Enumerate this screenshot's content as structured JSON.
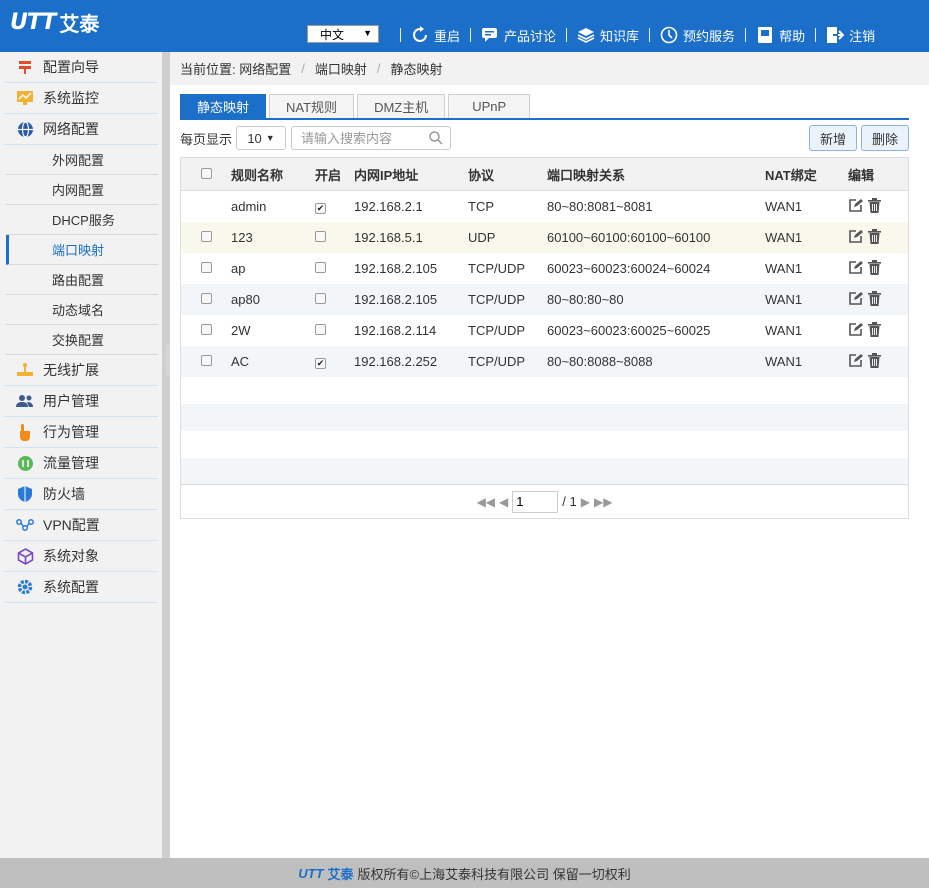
{
  "header": {
    "logo_mark": "UTT",
    "logo_cn": "艾泰",
    "language": "中文",
    "nav": [
      {
        "label": "重启",
        "icon": "restart-icon"
      },
      {
        "label": "产品讨论",
        "icon": "discussion-icon"
      },
      {
        "label": "知识库",
        "icon": "knowledge-base-icon"
      },
      {
        "label": "预约服务",
        "icon": "appointment-icon"
      },
      {
        "label": "帮助",
        "icon": "help-icon"
      },
      {
        "label": "注销",
        "icon": "logout-icon"
      }
    ]
  },
  "sidebar": {
    "items": [
      {
        "label": "配置向导",
        "icon": "wizard-icon"
      },
      {
        "label": "系统监控",
        "icon": "monitor-icon"
      },
      {
        "label": "网络配置",
        "icon": "network-icon"
      },
      {
        "label": "无线扩展",
        "icon": "wireless-icon"
      },
      {
        "label": "用户管理",
        "icon": "users-icon"
      },
      {
        "label": "行为管理",
        "icon": "behavior-icon"
      },
      {
        "label": "流量管理",
        "icon": "traffic-icon"
      },
      {
        "label": "防火墙",
        "icon": "firewall-icon"
      },
      {
        "label": "VPN配置",
        "icon": "vpn-icon"
      },
      {
        "label": "系统对象",
        "icon": "objects-icon"
      },
      {
        "label": "系统配置",
        "icon": "settings-icon"
      }
    ],
    "sub_items": [
      "外网配置",
      "内网配置",
      "DHCP服务",
      "端口映射",
      "路由配置",
      "动态域名",
      "交换配置"
    ],
    "active_sub": "端口映射"
  },
  "breadcrumb": {
    "prefix": "当前位置: 网络配置",
    "level2": "端口映射",
    "level3": "静态映射"
  },
  "tabs": [
    "静态映射",
    "NAT规则",
    "DMZ主机",
    "UPnP"
  ],
  "toolbar": {
    "per_page_label": "每页显示",
    "per_page_value": "10",
    "search_placeholder": "请输入搜索内容",
    "add_label": "新增",
    "delete_label": "删除"
  },
  "table": {
    "columns": [
      "规则名称",
      "开启",
      "内网IP地址",
      "协议",
      "端口映射关系",
      "NAT绑定",
      "编辑"
    ],
    "rows": [
      {
        "name": "admin",
        "enabled": true,
        "ip": "192.168.2.1",
        "protocol": "TCP",
        "mapping": "80~80:8081~8081",
        "nat": "WAN1"
      },
      {
        "name": "123",
        "enabled": false,
        "ip": "192.168.5.1",
        "protocol": "UDP",
        "mapping": "60100~60100:60100~60100",
        "nat": "WAN1"
      },
      {
        "name": "ap",
        "enabled": false,
        "ip": "192.168.2.105",
        "protocol": "TCP/UDP",
        "mapping": "60023~60023:60024~60024",
        "nat": "WAN1"
      },
      {
        "name": "ap80",
        "enabled": false,
        "ip": "192.168.2.105",
        "protocol": "TCP/UDP",
        "mapping": "80~80:80~80",
        "nat": "WAN1"
      },
      {
        "name": "2W",
        "enabled": false,
        "ip": "192.168.2.114",
        "protocol": "TCP/UDP",
        "mapping": "60023~60023:60025~60025",
        "nat": "WAN1"
      },
      {
        "name": "AC",
        "enabled": true,
        "ip": "192.168.2.252",
        "protocol": "TCP/UDP",
        "mapping": "80~80:8088~8088",
        "nat": "WAN1"
      }
    ]
  },
  "pager": {
    "current": "1",
    "total": "/ 1"
  },
  "footer": {
    "logo_mark": "UTT",
    "logo_cn": "艾泰",
    "text": "版权所有©上海艾泰科技有限公司 保留一切权利"
  },
  "colors": {
    "brand": "#1b6fc8",
    "footer_bg": "#bfbfbf"
  }
}
